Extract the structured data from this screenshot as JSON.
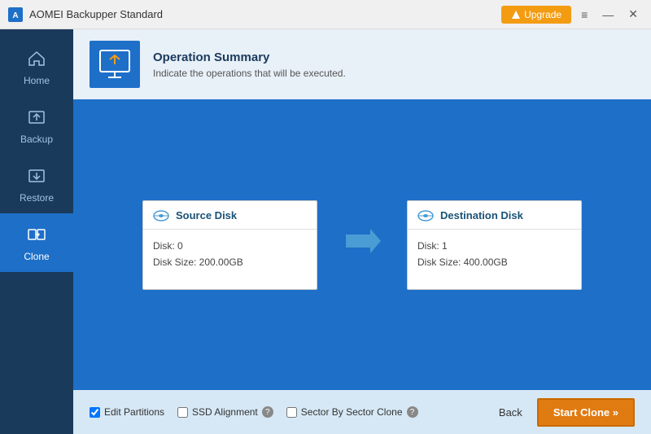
{
  "titleBar": {
    "title": "AOMEI Backupper Standard",
    "upgradeLabel": "Upgrade",
    "menuIcon": "≡",
    "minimizeIcon": "—",
    "closeIcon": "✕"
  },
  "sidebar": {
    "items": [
      {
        "id": "home",
        "label": "Home",
        "active": false
      },
      {
        "id": "backup",
        "label": "Backup",
        "active": false
      },
      {
        "id": "restore",
        "label": "Restore",
        "active": false
      },
      {
        "id": "clone",
        "label": "Clone",
        "active": true
      }
    ]
  },
  "operationSummary": {
    "title": "Operation Summary",
    "description": "Indicate the operations that will be executed."
  },
  "sourceDisk": {
    "title": "Source Disk",
    "disk": "Disk: 0",
    "diskSize": "Disk Size: 200.00GB"
  },
  "destinationDisk": {
    "title": "Destination Disk",
    "disk": "Disk: 1",
    "diskSize": "Disk Size: 400.00GB"
  },
  "footer": {
    "editPartitionsLabel": "Edit Partitions",
    "ssdAlignmentLabel": "SSD Alignment",
    "sectorBySectorLabel": "Sector By Sector Clone",
    "backLabel": "Back",
    "startCloneLabel": "Start Clone »"
  },
  "colors": {
    "orange": "#e07b12",
    "blue": "#1e6fc8",
    "darkBlue": "#1a3a5c",
    "arrowColor": "#4a9cd4"
  }
}
